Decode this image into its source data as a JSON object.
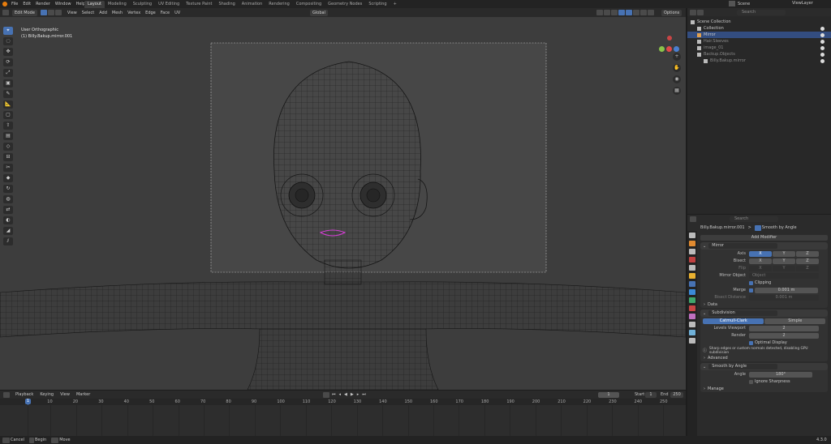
{
  "menu": [
    "File",
    "Edit",
    "Render",
    "Window",
    "Help"
  ],
  "workspace_tabs": [
    "Layout",
    "Modeling",
    "Sculpting",
    "UV Editing",
    "Texture Paint",
    "Shading",
    "Animation",
    "Rendering",
    "Compositing",
    "Geometry Nodes",
    "Scripting"
  ],
  "active_tab": "Layout",
  "tab_add": "+",
  "scene": {
    "label": "Scene",
    "layer": "ViewLayer"
  },
  "viewport_header": {
    "mode": "Edit Mode",
    "view": "View",
    "select": "Select",
    "add": "Add",
    "mesh": "Mesh",
    "vertex": "Vertex",
    "edge": "Edge",
    "face": "Face",
    "uv": "UV",
    "orientation": "Global",
    "options": "Options"
  },
  "viewport_overlay": {
    "view_name": "User Orthographic",
    "object_name": "(1) Billy.Bakup.mirror.001"
  },
  "toolbar_icons": [
    "cursor",
    "select-circle",
    "move",
    "rotate",
    "scale",
    "transform",
    "annotate",
    "measure",
    "add-cube",
    "extrude",
    "inset",
    "bevel",
    "loop-cut",
    "knife",
    "poly-build",
    "spin",
    "smooth",
    "edge-slide",
    "shrink",
    "shear",
    "rip"
  ],
  "outliner": {
    "search_placeholder": "Search",
    "items": [
      {
        "label": "Scene Collection",
        "selected": false,
        "indent": 0
      },
      {
        "label": "Collection",
        "selected": false,
        "indent": 1
      },
      {
        "label": "Mirror",
        "selected": true,
        "indent": 1
      },
      {
        "label": "Hair.Sleeves",
        "selected": false,
        "indent": 1
      },
      {
        "label": "image_01",
        "selected": false,
        "indent": 1
      },
      {
        "label": "Backup.Objects",
        "selected": false,
        "indent": 1
      },
      {
        "label": "Billy.Bakup.mirror",
        "selected": false,
        "indent": 2
      }
    ]
  },
  "properties": {
    "search_placeholder": "Search",
    "breadcrumb_object": "Billy.Bakup.mirror.001",
    "breadcrumb_sep": ">",
    "breadcrumb_modifier": "Smooth by Angle",
    "add_modifier": "Add Modifier",
    "mirror": {
      "name": "Mirror",
      "axis_label": "Axis",
      "bisect_label": "Bisect",
      "flip_label": "Flip",
      "x": "X",
      "y": "Y",
      "z": "Z",
      "mirror_object_label": "Mirror Object",
      "mirror_object_placeholder": "Object",
      "clipping": "Clipping",
      "merge_label": "Merge",
      "merge_value": "0.001 m",
      "bisect_distance_label": "Bisect Distance",
      "bisect_distance_value": "0.001 m",
      "data": "Data"
    },
    "subdivision": {
      "name": "Subdivision",
      "catmull": "Catmull-Clark",
      "simple": "Simple",
      "levels_label": "Levels Viewport",
      "levels_value": "2",
      "render_label": "Render",
      "render_value": "2",
      "optimal_display": "Optimal Display",
      "warning": "Sharp edges or custom normals detected, disabling GPU subdivision",
      "advanced": "Advanced"
    },
    "smooth": {
      "name": "Smooth by Angle",
      "angle_label": "Angle",
      "angle_value": "180°",
      "ignore_sharpness": "Ignore Sharpness",
      "manage": "Manage"
    }
  },
  "timeline": {
    "playback": "Playback",
    "keying": "Keying",
    "view": "View",
    "marker": "Marker",
    "current_frame": "1",
    "start_label": "Start",
    "start_value": "1",
    "end_label": "End",
    "end_value": "250",
    "frame_ticks": [
      "1",
      "10",
      "20",
      "30",
      "40",
      "50",
      "60",
      "70",
      "80",
      "90",
      "100",
      "110",
      "120",
      "130",
      "140",
      "150",
      "160",
      "170",
      "180",
      "190",
      "200",
      "210",
      "220",
      "230",
      "240",
      "250"
    ]
  },
  "statusbar": {
    "left1": "Cancel",
    "left2": "Begin",
    "left3": "Move",
    "version": "4.3.0"
  },
  "colors": {
    "accent": "#4772b3",
    "selection": "#334d80",
    "wire": "#141414",
    "lips": "#d63fd6"
  }
}
